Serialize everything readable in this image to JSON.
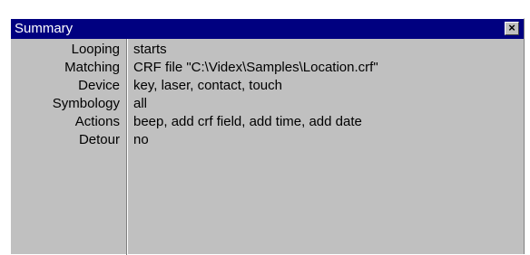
{
  "window": {
    "title": "Summary",
    "close_icon": "close-icon"
  },
  "rows": [
    {
      "label": "Looping",
      "value": "starts"
    },
    {
      "label": "Matching",
      "value": "CRF file \"C:\\Videx\\Samples\\Location.crf\""
    },
    {
      "label": "Device",
      "value": "key, laser, contact, touch"
    },
    {
      "label": "Symbology",
      "value": "all"
    },
    {
      "label": "Actions",
      "value": "beep, add crf field, add time, add date"
    },
    {
      "label": "Detour",
      "value": "no"
    }
  ],
  "colors": {
    "titlebar": "#000080",
    "panel": "#c0c0c0",
    "text": "#000000"
  }
}
